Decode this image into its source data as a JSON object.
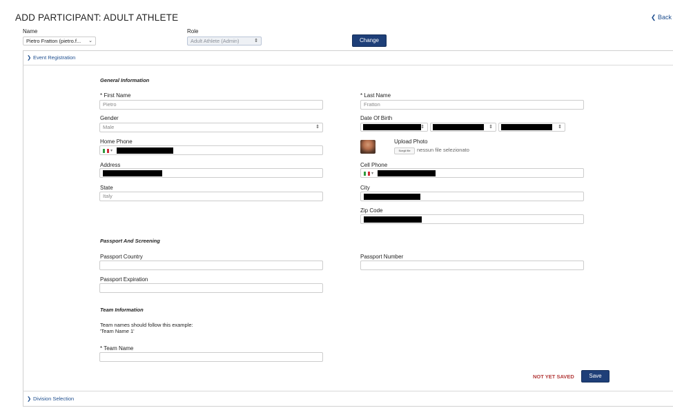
{
  "header": {
    "title": "ADD PARTICIPANT: ADULT ATHLETE",
    "back_label": "Back"
  },
  "top_form": {
    "name_label": "Name",
    "name_value": "Pietro Fratton (pietro.f...",
    "role_label": "Role",
    "role_value": "Adult Athlete (Admin)",
    "change_button": "Change"
  },
  "panels": {
    "event_registration": "Event Registration",
    "division_selection": "Division Selection"
  },
  "general": {
    "title": "General Information",
    "first_name_label": "* First Name",
    "first_name_value": "Pietro",
    "last_name_label": "* Last Name",
    "last_name_value": "Fratton",
    "gender_label": "Gender",
    "gender_value": "Male",
    "dob_label": "Date Of Birth",
    "home_phone_label": "Home Phone",
    "upload_photo_label": "Upload Photo",
    "choose_file_label": "Scegli file",
    "no_file_text": "nessun file selezionato",
    "address_label": "Address",
    "cell_phone_label": "Cell Phone",
    "state_label": "State",
    "state_value": "Italy",
    "city_label": "City",
    "zip_label": "Zip Code"
  },
  "passport": {
    "title": "Passport And Screening",
    "country_label": "Passport Country",
    "number_label": "Passport Number",
    "expiration_label": "Passport Expiration"
  },
  "team": {
    "title": "Team Information",
    "hint_line1": "Team names should follow this example:",
    "hint_line2": "'Team Name 1'",
    "team_name_label": "* Team Name"
  },
  "footer": {
    "status_text": "NOT YET SAVED",
    "save_button": "Save"
  },
  "colors": {
    "accent": "#1e3f78",
    "link": "#1f4f8f",
    "status_red": "#b33a3a",
    "flag_green": "#2f9a3e",
    "flag_red": "#cf2b37"
  }
}
